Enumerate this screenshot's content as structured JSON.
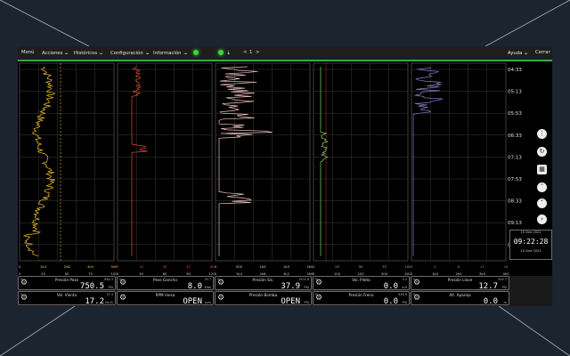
{
  "menu": {
    "items": [
      "Menú",
      "Acciones",
      "Históricos",
      "Configuración",
      "Información"
    ],
    "chevrons": [
      false,
      true,
      true,
      true,
      true
    ],
    "page_prev": "<",
    "page_num": "1",
    "page_next": ">",
    "help": "Ayuda",
    "close": "Cerrar"
  },
  "side_buttons": [
    "more-vertical-icon",
    "refresh-icon",
    "calendar-icon",
    "chevron-up-icon",
    "chevron-down-icon",
    "chevron-right-icon"
  ],
  "time_labels": [
    "04:33",
    "05:13",
    "05:53",
    "06:33",
    "07:13",
    "07:53",
    "08:33",
    "09:13",
    "09:53"
  ],
  "tracks": [
    {
      "color": "#f2c42c",
      "ticks1": [
        "0",
        "0",
        "0",
        "0",
        "0"
      ],
      "ticks2": [
        "0",
        "0",
        "0",
        "0",
        "0"
      ]
    },
    {
      "color": "#e84a2a",
      "ticks1": [
        "0",
        "15",
        "30",
        "45",
        "60"
      ],
      "ticks2": [
        "0",
        "25",
        "50",
        "75",
        "100"
      ]
    },
    {
      "color": "#f2c0c4",
      "ticks1": [
        "0",
        "500",
        "1k0",
        "1k5",
        "2k0"
      ],
      "ticks2": [
        "0",
        "0",
        "0",
        "0",
        "0"
      ]
    },
    {
      "color": "#86d25a",
      "ticks1": [
        "0",
        "25",
        "50",
        "75",
        "100"
      ],
      "ticks2": [
        "0",
        "0",
        "0",
        "0",
        "0"
      ]
    },
    {
      "color": "#8e7acd",
      "ticks1": [
        "0",
        "0",
        "0",
        "0",
        "0"
      ],
      "ticks2": [
        "0",
        "0",
        "0",
        "0",
        "0"
      ]
    }
  ],
  "track_ticks_row1": [
    [
      "0",
      "1k4",
      "2k8",
      "4k0",
      "5k6"
    ],
    [
      "0",
      "15",
      "30",
      "45",
      "60"
    ],
    [
      "0",
      "500",
      "1k0",
      "1k5",
      "2k0"
    ],
    [
      "0",
      "25",
      "50",
      "75",
      "100"
    ],
    [
      "0",
      "4",
      "8",
      "12",
      "16"
    ]
  ],
  "track_ticks_row2": [
    [
      "0",
      "25",
      "50",
      "75",
      "100"
    ],
    [
      "0",
      "30",
      "60",
      "90",
      "120"
    ],
    [
      "0",
      "1k4",
      "2k8",
      "4k2",
      "5k6"
    ],
    [
      "0",
      "100",
      "200",
      "300",
      "400"
    ],
    [
      "0",
      "1k0",
      "2k0",
      "3k0",
      "4k0"
    ]
  ],
  "readouts": {
    "row1": [
      {
        "label": "Presión Pozo",
        "low": "0",
        "high": "884.3",
        "value": "750.5",
        "unit": "PSI"
      },
      {
        "label": "Peso Gancho",
        "low": "0",
        "high": "35.7",
        "value": "8.0",
        "unit": "Klbs"
      },
      {
        "label": "Presión Sis.",
        "low": "0",
        "high": "1501.8",
        "value": "37.9",
        "unit": "PSI"
      },
      {
        "label": "Vol. Pileta",
        "low": "0",
        "high": "0.2",
        "value": "0.0",
        "unit": "m3"
      },
      {
        "label": "Presión Llave",
        "low": "0",
        "high": "640.7",
        "value": "12.7",
        "unit": "PSI"
      }
    ],
    "row2": [
      {
        "label": "Vel. Viento",
        "low": "0",
        "high": "37.3",
        "value": "17.2",
        "unit": "km/h"
      },
      {
        "label": "RPM mesa",
        "low": "",
        "high": "",
        "value": "OPEN",
        "unit": "rpm"
      },
      {
        "label": "Presión Bomba",
        "low": "",
        "high": "",
        "value": "OPEN",
        "unit": "PSI"
      },
      {
        "label": "Presión Freno",
        "low": "0",
        "high": "646.6",
        "value": "0.0",
        "unit": "PSI"
      },
      {
        "label": "Alt. Aparejo",
        "low": "0",
        "high": "",
        "value": "0.0",
        "unit": "m"
      }
    ]
  },
  "clock": {
    "date_top": "15 Dne 2022",
    "time": "09:22:28",
    "date_bottom": "15 Dne 2022"
  }
}
